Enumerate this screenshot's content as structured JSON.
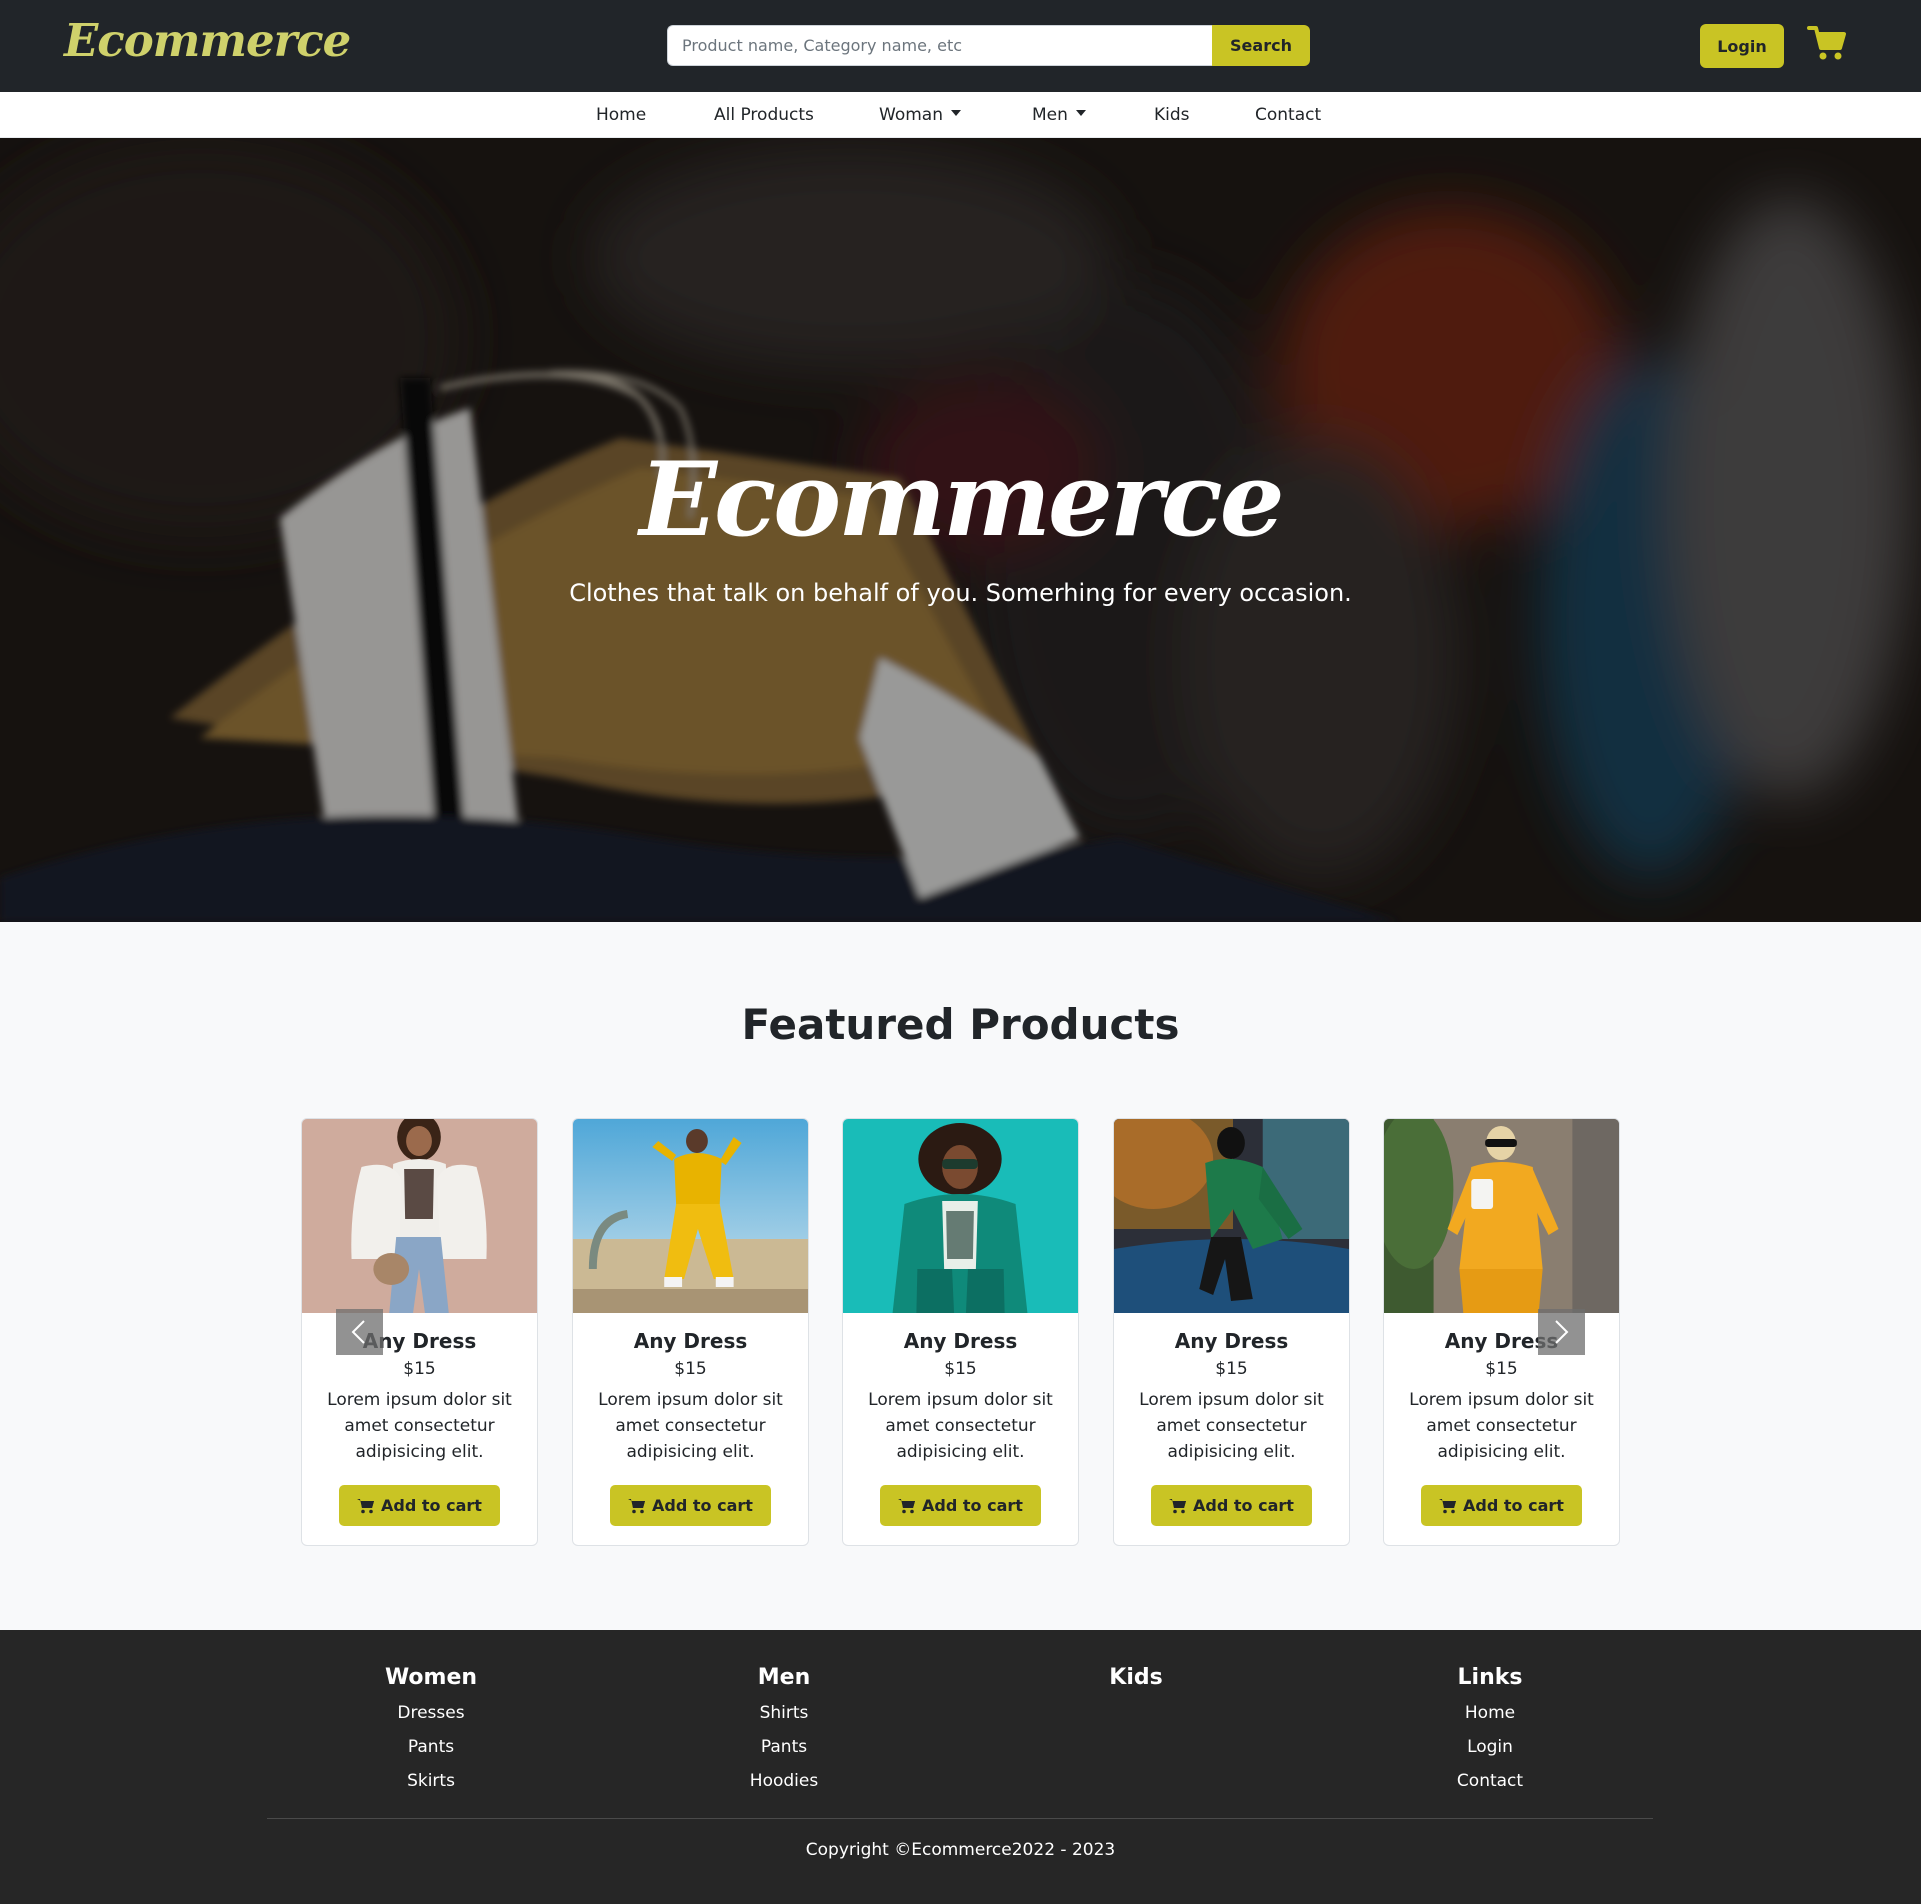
{
  "header": {
    "logo": "Ecommerce",
    "search_placeholder": "Product name, Category name, etc",
    "search_label": "Search",
    "login_label": "Login",
    "cart_icon": "shopping-cart-icon"
  },
  "nav": {
    "home": "Home",
    "all_products": "All Products",
    "woman": "Woman",
    "men": "Men",
    "kids": "Kids",
    "contact": "Contact"
  },
  "hero": {
    "title": "Ecommerce",
    "subtitle": "Clothes that talk on behalf of you. Somerhing for every occasion."
  },
  "featured": {
    "title": "Featured Products",
    "products": [
      {
        "name": "Any Dress",
        "price": "$15",
        "desc": "Lorem ipsum dolor sit amet consectetur adipisicing elit.",
        "button": "Add to cart"
      },
      {
        "name": "Any Dress",
        "price": "$15",
        "desc": "Lorem ipsum dolor sit amet consectetur adipisicing elit.",
        "button": "Add to cart"
      },
      {
        "name": "Any Dress",
        "price": "$15",
        "desc": "Lorem ipsum dolor sit amet consectetur adipisicing elit.",
        "button": "Add to cart"
      },
      {
        "name": "Any Dress",
        "price": "$15",
        "desc": "Lorem ipsum dolor sit amet consectetur adipisicing elit.",
        "button": "Add to cart"
      },
      {
        "name": "Any Dress",
        "price": "$15",
        "desc": "Lorem ipsum dolor sit amet consectetur adipisicing elit.",
        "button": "Add to cart"
      }
    ],
    "prev_icon": "chevron-left-icon",
    "next_icon": "chevron-right-icon"
  },
  "footer": {
    "columns": [
      {
        "title": "Women",
        "links": [
          "Dresses",
          "Pants",
          "Skirts"
        ]
      },
      {
        "title": "Men",
        "links": [
          "Shirts",
          "Pants",
          "Hoodies"
        ]
      },
      {
        "title": "Kids",
        "links": []
      },
      {
        "title": "Links",
        "links": [
          "Home",
          "Login",
          "Contact"
        ]
      }
    ],
    "copyright": "Copyright ©Ecommerce2022 - 2023"
  },
  "colors": {
    "accent": "#c9c424",
    "header_bg": "#212529",
    "footer_bg": "#262626",
    "logo": "#cfd16b"
  }
}
